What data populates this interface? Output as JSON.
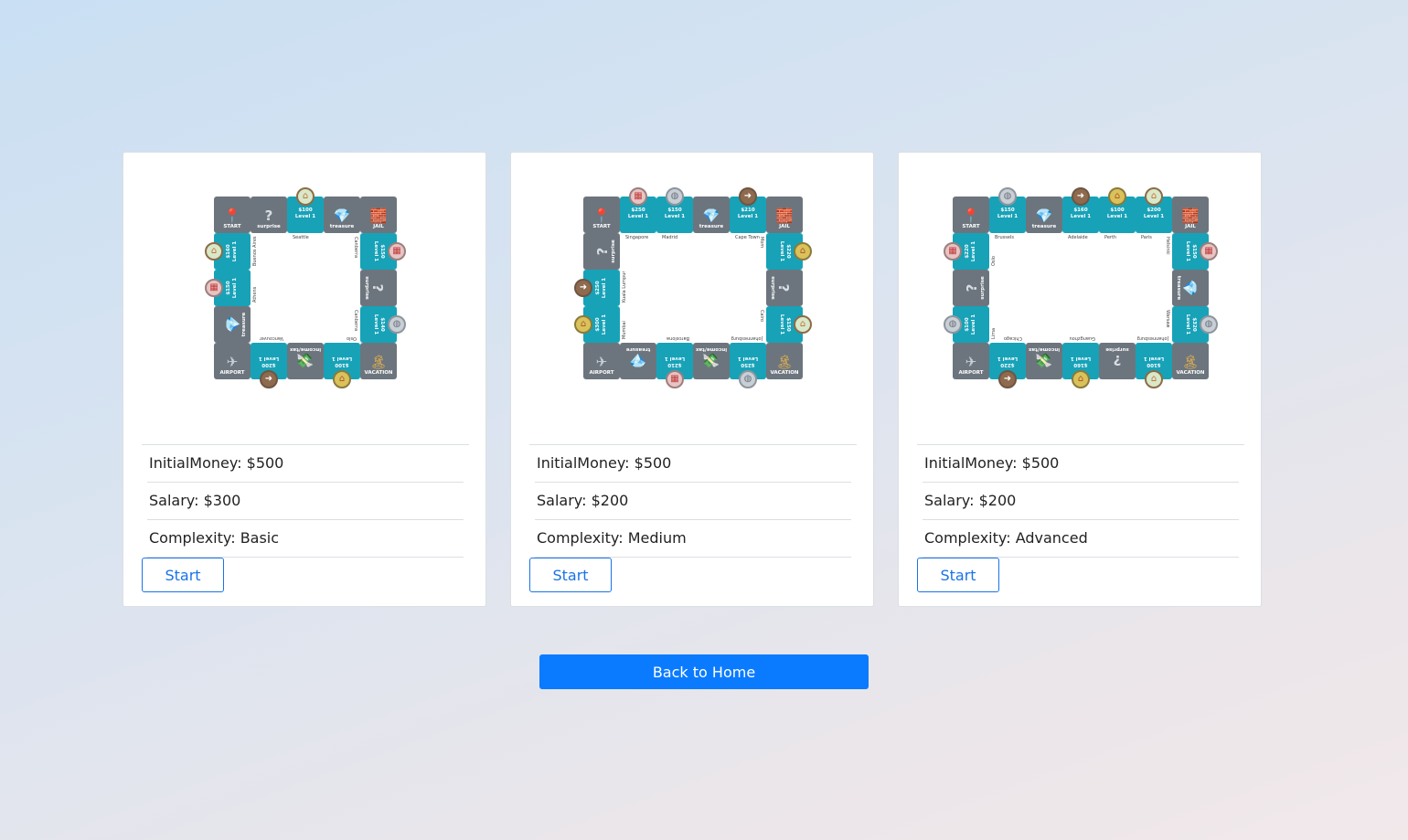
{
  "scenarios": [
    {
      "stats": {
        "initial_label": "InitialMoney:",
        "initial_value": "$500",
        "salary_label": "Salary:",
        "salary_value": "$300",
        "complexity_label": "Complexity:",
        "complexity_value": "Basic"
      },
      "start_label": "Start",
      "board": {
        "top": [
          {
            "type": "special",
            "glyph": "📍",
            "label": "START"
          },
          {
            "type": "special",
            "glyph": "?",
            "label": "surprise"
          },
          {
            "type": "prop",
            "price": "$100",
            "level": "Level 1",
            "city": "Seattle"
          },
          {
            "type": "special",
            "glyph": "💎",
            "label": "treasure"
          },
          {
            "type": "special",
            "glyph": "🧱",
            "label": "JAIL"
          }
        ],
        "right": [
          {
            "type": "prop",
            "price": "$150",
            "level": "Level 1",
            "city": "Canberra"
          },
          {
            "type": "special",
            "glyph": "?",
            "label": "surprise"
          },
          {
            "type": "prop",
            "price": "$140",
            "level": "Level 1",
            "city": "Canberra"
          }
        ],
        "bottom": [
          {
            "type": "special",
            "glyph": "✈",
            "label": "AIRPORT"
          },
          {
            "type": "prop",
            "price": "$200",
            "level": "Level 1",
            "city": "Vancouver"
          },
          {
            "type": "special",
            "glyph": "💸",
            "label": "income/tax"
          },
          {
            "type": "prop",
            "price": "$100",
            "level": "Level 1",
            "city": "Oslo"
          },
          {
            "type": "special",
            "glyph": "🏝",
            "label": "VACATION"
          }
        ],
        "left": [
          {
            "type": "prop",
            "price": "$160",
            "level": "Level 1",
            "city": "Buenos Aires"
          },
          {
            "type": "prop",
            "price": "$150",
            "level": "Level 1",
            "city": "Athens"
          },
          {
            "type": "special",
            "glyph": "💎",
            "label": "treasure"
          }
        ]
      }
    },
    {
      "stats": {
        "initial_label": "InitialMoney:",
        "initial_value": "$500",
        "salary_label": "Salary:",
        "salary_value": "$200",
        "complexity_label": "Complexity:",
        "complexity_value": "Medium"
      },
      "start_label": "Start",
      "board": {
        "top": [
          {
            "type": "special",
            "glyph": "📍",
            "label": "START"
          },
          {
            "type": "prop",
            "price": "$250",
            "level": "Level 1",
            "city": "Singapore"
          },
          {
            "type": "prop",
            "price": "$150",
            "level": "Level 1",
            "city": "Madrid"
          },
          {
            "type": "special",
            "glyph": "💎",
            "label": "treasure"
          },
          {
            "type": "prop",
            "price": "$210",
            "level": "Level 1",
            "city": "Cape Town"
          },
          {
            "type": "special",
            "glyph": "🧱",
            "label": "JAIL"
          }
        ],
        "right": [
          {
            "type": "prop",
            "price": "$220",
            "level": "Level 1",
            "city": "Mom"
          },
          {
            "type": "special",
            "glyph": "?",
            "label": "surprise"
          },
          {
            "type": "prop",
            "price": "$150",
            "level": "Level 1",
            "city": "Cairo"
          }
        ],
        "bottom": [
          {
            "type": "special",
            "glyph": "✈",
            "label": "AIRPORT"
          },
          {
            "type": "special",
            "glyph": "💎",
            "label": "treasure"
          },
          {
            "type": "prop",
            "price": "$210",
            "level": "Level 1",
            "city": "Barcelona"
          },
          {
            "type": "special",
            "glyph": "💸",
            "label": "income/tax"
          },
          {
            "type": "prop",
            "price": "$250",
            "level": "Level 1",
            "city": "Johannesburg"
          },
          {
            "type": "special",
            "glyph": "🏝",
            "label": "VACATION"
          }
        ],
        "left": [
          {
            "type": "special",
            "glyph": "?",
            "label": "surprise"
          },
          {
            "type": "prop",
            "price": "$250",
            "level": "Level 1",
            "city": "Kuala Lumpur"
          },
          {
            "type": "prop",
            "price": "$300",
            "level": "Level 1",
            "city": "Mumbai"
          }
        ]
      }
    },
    {
      "stats": {
        "initial_label": "InitialMoney:",
        "initial_value": "$500",
        "salary_label": "Salary:",
        "salary_value": "$200",
        "complexity_label": "Complexity:",
        "complexity_value": "Advanced"
      },
      "start_label": "Start",
      "board": {
        "top": [
          {
            "type": "special",
            "glyph": "📍",
            "label": "START"
          },
          {
            "type": "prop",
            "price": "$150",
            "level": "Level 1",
            "city": "Brussels"
          },
          {
            "type": "special",
            "glyph": "💎",
            "label": "treasure"
          },
          {
            "type": "prop",
            "price": "$160",
            "level": "Level 1",
            "city": "Adelaide"
          },
          {
            "type": "prop",
            "price": "$100",
            "level": "Level 1",
            "city": "Perth"
          },
          {
            "type": "prop",
            "price": "$200",
            "level": "Level 1",
            "city": "Paris"
          },
          {
            "type": "special",
            "glyph": "🧱",
            "label": "JAIL"
          }
        ],
        "right": [
          {
            "type": "prop",
            "price": "$150",
            "level": "Level 1",
            "city": "Helsinki"
          },
          {
            "type": "special",
            "glyph": "💎",
            "label": "treasure"
          },
          {
            "type": "prop",
            "price": "$320",
            "level": "Level 1",
            "city": "Warsaw"
          }
        ],
        "bottom": [
          {
            "type": "special",
            "glyph": "✈",
            "label": "AIRPORT"
          },
          {
            "type": "prop",
            "price": "$220",
            "level": "Level 1",
            "city": "Chicago"
          },
          {
            "type": "special",
            "glyph": "💸",
            "label": "income/tax"
          },
          {
            "type": "prop",
            "price": "$160",
            "level": "Level 1",
            "city": "Guangzhou"
          },
          {
            "type": "special",
            "glyph": "?",
            "label": "surprise"
          },
          {
            "type": "prop",
            "price": "$100",
            "level": "Level 1",
            "city": "Johannesburg"
          },
          {
            "type": "special",
            "glyph": "🏝",
            "label": "VACATION"
          }
        ],
        "left": [
          {
            "type": "prop",
            "price": "$220",
            "level": "Level 1",
            "city": "Oslo"
          },
          {
            "type": "special",
            "glyph": "?",
            "label": "surprise"
          },
          {
            "type": "prop",
            "price": "$100",
            "level": "Level 1",
            "city": "Lima"
          }
        ]
      }
    }
  ],
  "home_button_label": "Back to Home"
}
